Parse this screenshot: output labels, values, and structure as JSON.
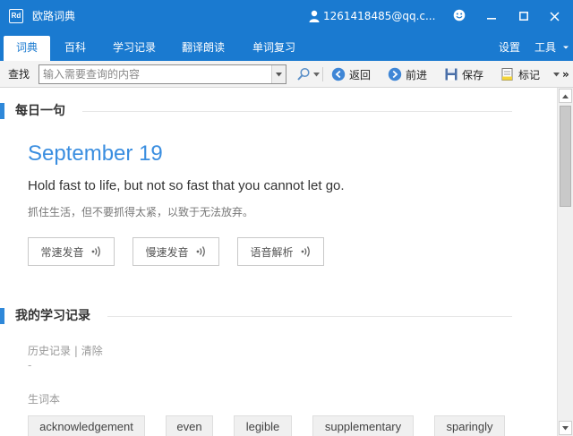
{
  "window": {
    "app_title": "欧路词典",
    "app_logo": "Rd",
    "user_email": "1261418485@qq.c...",
    "icons": [
      "user-icon",
      "smiley-icon",
      "minimize-icon",
      "maximize-icon",
      "close-icon"
    ]
  },
  "menu": {
    "tabs": [
      {
        "label": "词典",
        "active": true
      },
      {
        "label": "百科"
      },
      {
        "label": "学习记录"
      },
      {
        "label": "翻译朗读"
      },
      {
        "label": "单词复习"
      }
    ],
    "settings_label": "设置",
    "tools_label": "工具"
  },
  "toolbar": {
    "search_label": "查找",
    "search_placeholder": "输入需要查询的内容",
    "back_label": "返回",
    "forward_label": "前进",
    "save_label": "保存",
    "mark_label": "标记",
    "more_label": "»"
  },
  "daily": {
    "section_title": "每日一句",
    "date": "September 19",
    "sentence_en": "Hold fast to life, but not so fast that you cannot let go.",
    "sentence_zh": "抓住生活，但不要抓得太紧，以致于无法放弃。",
    "buttons": [
      "常速发音",
      "慢速发音",
      "语音解析"
    ]
  },
  "study": {
    "section_title": "我的学习记录",
    "history_label": "历史记录",
    "separator": " | ",
    "clear_label": "清除",
    "empty_history": "-",
    "wordbook_label": "生词本",
    "words": [
      "acknowledgement",
      "even",
      "legible",
      "supplementary",
      "sparingly"
    ]
  },
  "colors": {
    "accent": "#1a7ad0",
    "date_blue": "#3a8ee0",
    "section_bar": "#2f88d9"
  }
}
